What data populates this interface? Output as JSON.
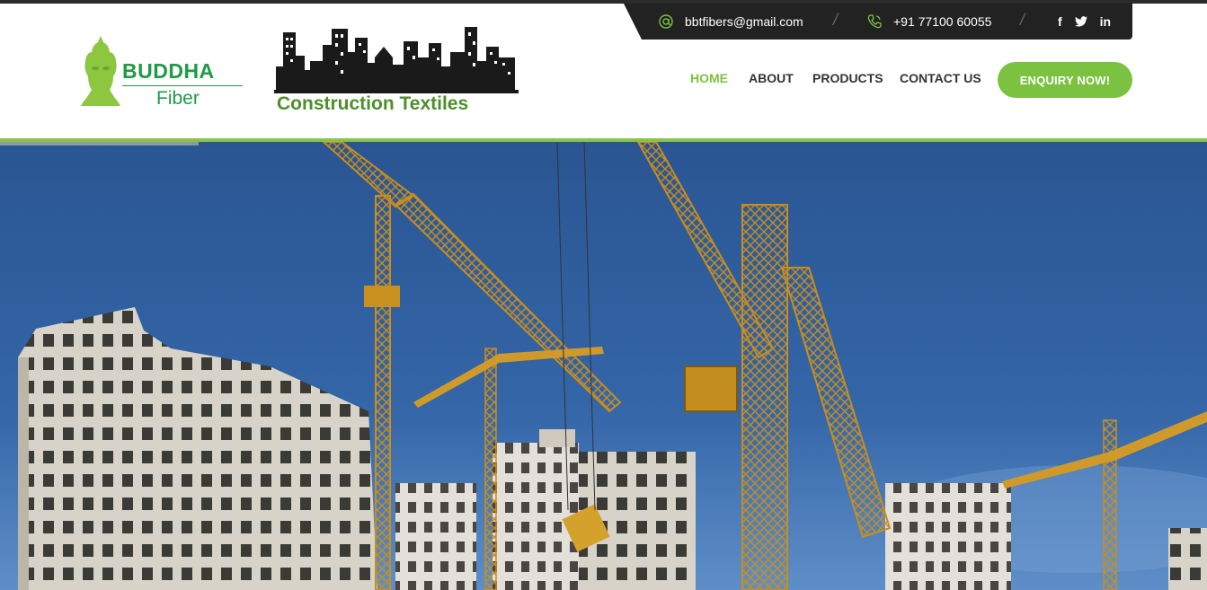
{
  "contact": {
    "email": "bbtfibers@gmail.com",
    "phone": "+91 77100 60055",
    "email_icon": "at-icon",
    "phone_icon": "phone-icon",
    "separator": "/"
  },
  "social": {
    "facebook": "f",
    "twitter": "twitter-icon",
    "linkedin": "in"
  },
  "logo_primary": {
    "brand": "BUDDHA",
    "sub": "Fiber"
  },
  "logo_secondary": {
    "tagline": "Construction Textiles"
  },
  "nav": {
    "items": [
      {
        "label": "HOME",
        "active": true
      },
      {
        "label": "ABOUT",
        "active": false
      },
      {
        "label": "PRODUCTS",
        "active": false
      },
      {
        "label": "CONTACT US",
        "active": false
      }
    ],
    "cta": "ENQUIRY NOW!"
  },
  "colors": {
    "accent": "#7cc241",
    "brand_green": "#1f9a47",
    "topbar": "#222222",
    "sky": "#2d5a96",
    "crane": "#d4a22c"
  },
  "hero": {
    "image": "construction-cranes-photo"
  }
}
